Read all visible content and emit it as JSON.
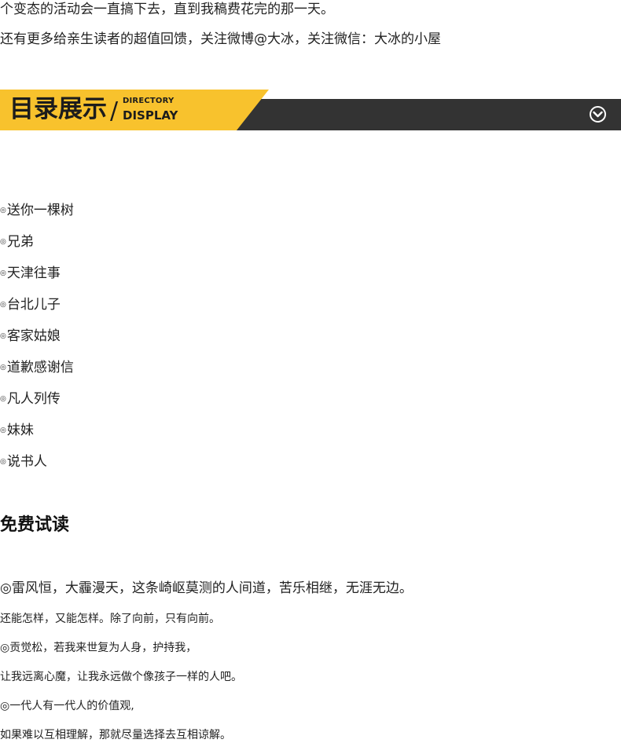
{
  "intro": {
    "line1": "个变态的活动会一直搞下去，直到我稿费花完的那一天。",
    "line2": "还有更多给亲生读者的超值回馈，关注微博@大冰，关注微信：大冰的小屋"
  },
  "banner": {
    "title": "目录展示",
    "slash": "/",
    "en_small": "DIRECTORY",
    "en_big": "DISPLAY",
    "icon": "chevron-down-circle-icon",
    "colors": {
      "yellow": "#f8c22d",
      "dark": "#333333"
    }
  },
  "directory": {
    "bullet": "◎",
    "items": [
      "送你一棵树",
      "兄弟",
      "天津往事",
      "台北儿子",
      "客家姑娘",
      "道歉感谢信",
      "凡人列传",
      "妹妹",
      "说书人"
    ]
  },
  "trial": {
    "title": "免费试读",
    "lines": [
      "◎雷风恒，大霾漫天，这条崎岖莫测的人间道，苦乐相继，无涯无边。",
      "还能怎样，又能怎样。除了向前，只有向前。",
      "◎贡觉松，若我来世复为人身，护持我，",
      "让我远离心魔，让我永远做个像孩子一样的人吧。",
      "◎一代人有一代人的价值观,",
      "如果难以互相理解，那就尽量选择去互相谅解。"
    ]
  }
}
